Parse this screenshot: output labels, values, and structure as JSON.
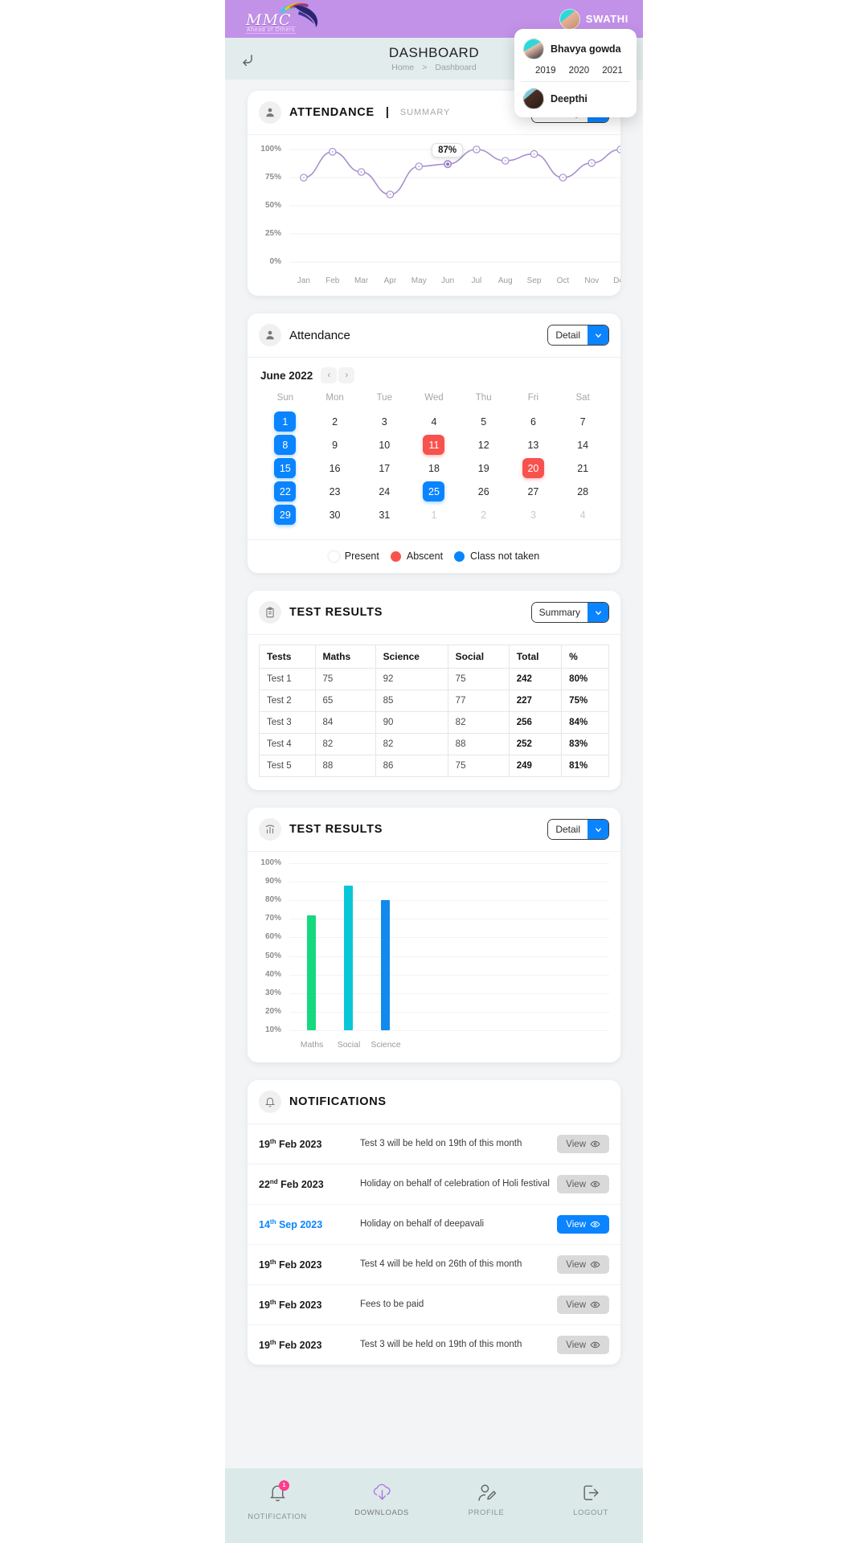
{
  "header": {
    "logo_text": "MMC",
    "logo_tagline": "Ahead of Others",
    "user_name": "SWATHI"
  },
  "student_dropdown": {
    "students": [
      {
        "name": "Bhavya gowda",
        "years": [
          "2019",
          "2020",
          "2021"
        ]
      },
      {
        "name": "Deepthi",
        "years": []
      }
    ]
  },
  "breadcrumb": {
    "title": "DASHBOARD",
    "home": "Home",
    "separator": ">",
    "current": "Dashboard"
  },
  "attendance_summary": {
    "title": "ATTENDANCE",
    "separator": "|",
    "subtitle": "SUMMARY",
    "select_label": "Summary",
    "tooltip": "87%"
  },
  "attendance_detail": {
    "title": "Attendance",
    "select_label": "Detail",
    "month": "June 2022",
    "prev": "‹",
    "next": "›",
    "dow": [
      "Sun",
      "Mon",
      "Tue",
      "Wed",
      "Thu",
      "Fri",
      "Sat"
    ],
    "weeks": [
      [
        {
          "d": "1",
          "s": "blue"
        },
        {
          "d": "2",
          "s": ""
        },
        {
          "d": "3",
          "s": ""
        },
        {
          "d": "4",
          "s": ""
        },
        {
          "d": "5",
          "s": ""
        },
        {
          "d": "6",
          "s": ""
        },
        {
          "d": "7",
          "s": ""
        }
      ],
      [
        {
          "d": "8",
          "s": "blue"
        },
        {
          "d": "9",
          "s": ""
        },
        {
          "d": "10",
          "s": ""
        },
        {
          "d": "11",
          "s": "red"
        },
        {
          "d": "12",
          "s": ""
        },
        {
          "d": "13",
          "s": ""
        },
        {
          "d": "14",
          "s": ""
        }
      ],
      [
        {
          "d": "15",
          "s": "blue"
        },
        {
          "d": "16",
          "s": ""
        },
        {
          "d": "17",
          "s": ""
        },
        {
          "d": "18",
          "s": ""
        },
        {
          "d": "19",
          "s": ""
        },
        {
          "d": "20",
          "s": "red"
        },
        {
          "d": "21",
          "s": ""
        }
      ],
      [
        {
          "d": "22",
          "s": "blue"
        },
        {
          "d": "23",
          "s": ""
        },
        {
          "d": "24",
          "s": ""
        },
        {
          "d": "25",
          "s": "blue"
        },
        {
          "d": "26",
          "s": ""
        },
        {
          "d": "27",
          "s": ""
        },
        {
          "d": "28",
          "s": ""
        }
      ],
      [
        {
          "d": "29",
          "s": "blue"
        },
        {
          "d": "30",
          "s": ""
        },
        {
          "d": "31",
          "s": ""
        },
        {
          "d": "1",
          "s": "mute"
        },
        {
          "d": "2",
          "s": "mute"
        },
        {
          "d": "3",
          "s": "mute"
        },
        {
          "d": "4",
          "s": "mute"
        }
      ]
    ],
    "legend": [
      {
        "label": "Present",
        "color": "#ffffff"
      },
      {
        "label": "Abscent",
        "color": "#f8524e"
      },
      {
        "label": "Class not taken",
        "color": "#0a84ff"
      }
    ]
  },
  "test_results_summary": {
    "title": "TEST RESULTS",
    "select_label": "Summary",
    "columns": [
      "Tests",
      "Maths",
      "Science",
      "Social",
      "Total",
      "%"
    ],
    "rows": [
      [
        "Test 1",
        "75",
        "92",
        "75",
        "242",
        "80%"
      ],
      [
        "Test 2",
        "65",
        "85",
        "77",
        "227",
        "75%"
      ],
      [
        "Test 3",
        "84",
        "90",
        "82",
        "256",
        "84%"
      ],
      [
        "Test 4",
        "82",
        "82",
        "88",
        "252",
        "83%"
      ],
      [
        "Test 5",
        "88",
        "86",
        "75",
        "249",
        "81%"
      ]
    ]
  },
  "test_results_detail": {
    "title": "TEST RESULTS",
    "select_label": "Detail"
  },
  "notifications": {
    "title": "NOTIFICATIONS",
    "items": [
      {
        "day": "19",
        "ord": "th",
        "date": "Feb 2023",
        "text": "Test 3 will be held on 19th of this month",
        "view": "View",
        "highlight": false
      },
      {
        "day": "22",
        "ord": "nd",
        "date": "Feb 2023",
        "text": "Holiday on behalf of celebration of Holi festival",
        "view": "View",
        "highlight": false
      },
      {
        "day": "14",
        "ord": "th",
        "date": "Sep 2023",
        "text": "Holiday on behalf of deepavali",
        "view": "View",
        "highlight": true
      },
      {
        "day": "19",
        "ord": "th",
        "date": "Feb 2023",
        "text": "Test 4 will be held on 26th of this month",
        "view": "View",
        "highlight": false
      },
      {
        "day": "19",
        "ord": "th",
        "date": "Feb 2023",
        "text": "Fees to be paid",
        "view": "View",
        "highlight": false
      },
      {
        "day": "19",
        "ord": "th",
        "date": "Feb 2023",
        "text": "Test 3 will be held on 19th of this month",
        "view": "View",
        "highlight": false
      }
    ]
  },
  "bottom_nav": {
    "items": [
      {
        "label": "NOTIFICATION",
        "icon": "bell-icon",
        "badge": "1"
      },
      {
        "label": "DOWNLOADS",
        "icon": "cloud-download-icon",
        "badge": ""
      },
      {
        "label": "PROFILE",
        "icon": "profile-edit-icon",
        "badge": ""
      },
      {
        "label": "LOGOUT",
        "icon": "logout-icon",
        "badge": ""
      }
    ]
  },
  "chart_data": [
    {
      "type": "line",
      "title": "ATTENDANCE | SUMMARY",
      "xlabel": "",
      "ylabel": "",
      "categories": [
        "Jan",
        "Feb",
        "Mar",
        "Apr",
        "May",
        "Jun",
        "Jul",
        "Aug",
        "Sep",
        "Oct",
        "Nov",
        "Dec"
      ],
      "values": [
        75,
        98,
        80,
        60,
        85,
        87,
        100,
        90,
        96,
        75,
        88,
        100
      ],
      "ytick_labels": [
        "100%",
        "75%",
        "50%",
        "25%",
        "0%"
      ],
      "yticks": [
        100,
        75,
        50,
        25,
        0
      ],
      "ylim": [
        0,
        100
      ],
      "grid": true,
      "legend": "none",
      "annotations": [
        {
          "label": "87%",
          "at_category": "Jun",
          "value": 87
        }
      ],
      "line_color": "#a78fd0",
      "marker": "circle"
    },
    {
      "type": "bar",
      "title": "TEST RESULTS",
      "xlabel": "",
      "ylabel": "",
      "categories": [
        "Maths",
        "Social",
        "Science"
      ],
      "values": [
        72,
        88,
        80
      ],
      "colors": [
        "#16d97f",
        "#0ac7d8",
        "#128aed"
      ],
      "ytick_labels": [
        "100%",
        "90%",
        "80%",
        "70%",
        "60%",
        "50%",
        "40%",
        "30%",
        "20%",
        "10%"
      ],
      "yticks": [
        100,
        90,
        80,
        70,
        60,
        50,
        40,
        30,
        20,
        10
      ],
      "ylim": [
        10,
        100
      ],
      "grid": true,
      "legend": "none"
    }
  ]
}
